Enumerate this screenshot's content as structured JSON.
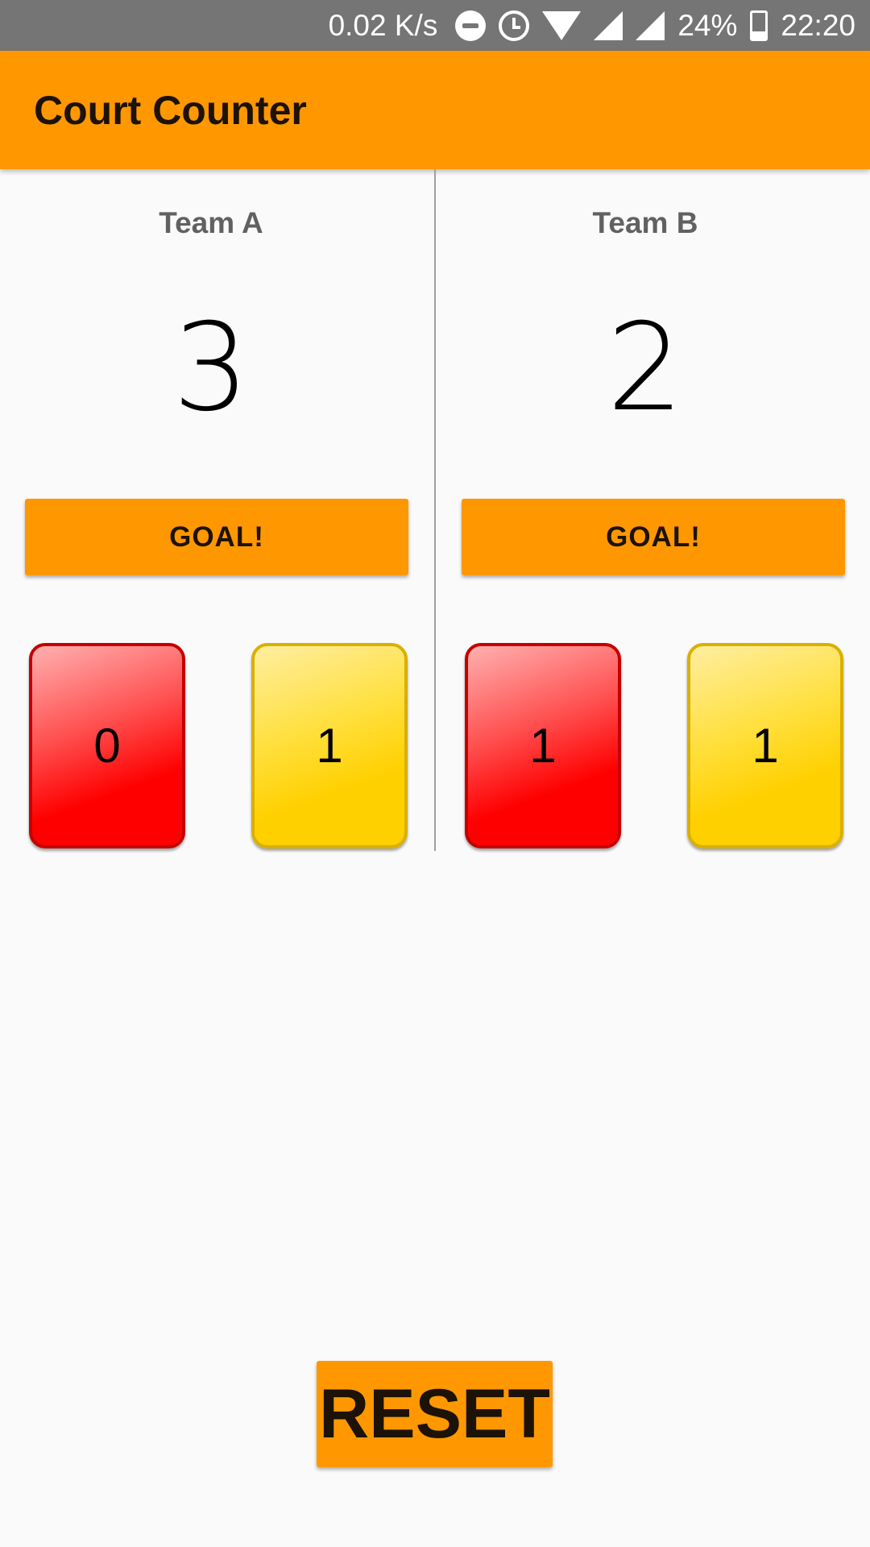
{
  "status_bar": {
    "speed": "0.02 K/s",
    "icons": [
      "dnd-icon",
      "alarm-icon",
      "wifi-icon",
      "signal-icon",
      "battery-icon"
    ],
    "battery": "24%",
    "time": "22:20"
  },
  "app_bar": {
    "title": "Court Counter",
    "color": "#ff9800"
  },
  "team_a": {
    "name": "Team A",
    "score": "3",
    "goal_label": "GOAL!",
    "red_cards": "0",
    "yellow_cards": "1"
  },
  "team_b": {
    "name": "Team B",
    "score": "2",
    "goal_label": "GOAL!",
    "red_cards": "1",
    "yellow_cards": "1"
  },
  "reset_label": "RESET",
  "colors": {
    "accent": "#ff9800",
    "red_card": "#ff0000",
    "yellow_card": "#ffd000"
  }
}
